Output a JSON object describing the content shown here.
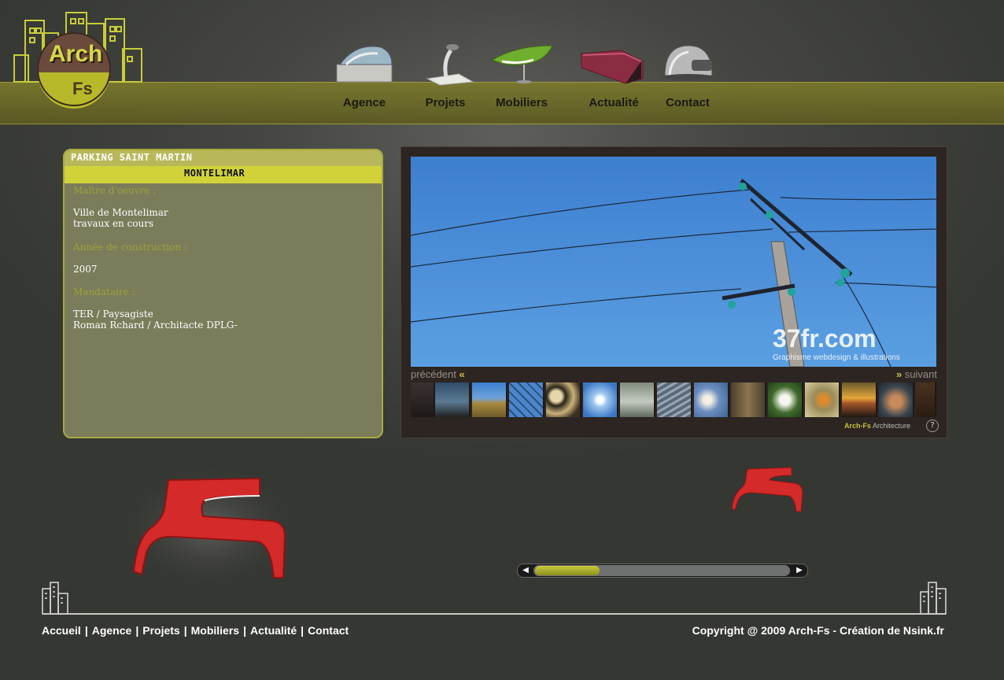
{
  "logo": {
    "line1": "Arch",
    "line2": "Fs"
  },
  "nav": [
    {
      "label": "Agence",
      "icon": "building-model-icon"
    },
    {
      "label": "Projets",
      "icon": "sculpture-lamp-icon"
    },
    {
      "label": "Mobiliers",
      "icon": "chair-icon"
    },
    {
      "label": "Actualité",
      "icon": "sofa-icon"
    },
    {
      "label": "Contact",
      "icon": "dome-icon"
    }
  ],
  "project": {
    "title": "PARKING SAINT MARTIN",
    "city": "MONTELIMAR",
    "owner_label": "Maître d'oeuvre :",
    "owner_lines": [
      "Ville de Montelimar",
      "travaux en cours"
    ],
    "year_label": "Année de construction :",
    "year": "2007",
    "mandate_label": "Mandataire :",
    "mandate_lines": [
      "TER / Paysagiste",
      "Roman Rchard / Architacte DPLG-"
    ]
  },
  "gallery": {
    "watermark": "37fr.com",
    "watermark_sub": "Graphisme webdesign & illustrations",
    "prev_label": "précédent",
    "next_label": "suivant",
    "credit_brand": "Arch-Fs",
    "credit_text": "Architecture",
    "help": "?"
  },
  "footer": {
    "links": [
      "Accueil",
      "Agence",
      "Projets",
      "Mobiliers",
      "Actualité",
      "Contact"
    ],
    "copyright": "Copyright @ 2009 Arch-Fs - Création de Nsink.fr"
  },
  "colors": {
    "accent": "#c8cc3a",
    "header_band": "#6e6d28",
    "panel_bg": "#7b7c5a",
    "sky": "#4a8ad6",
    "chair_red": "#d42a2a"
  }
}
